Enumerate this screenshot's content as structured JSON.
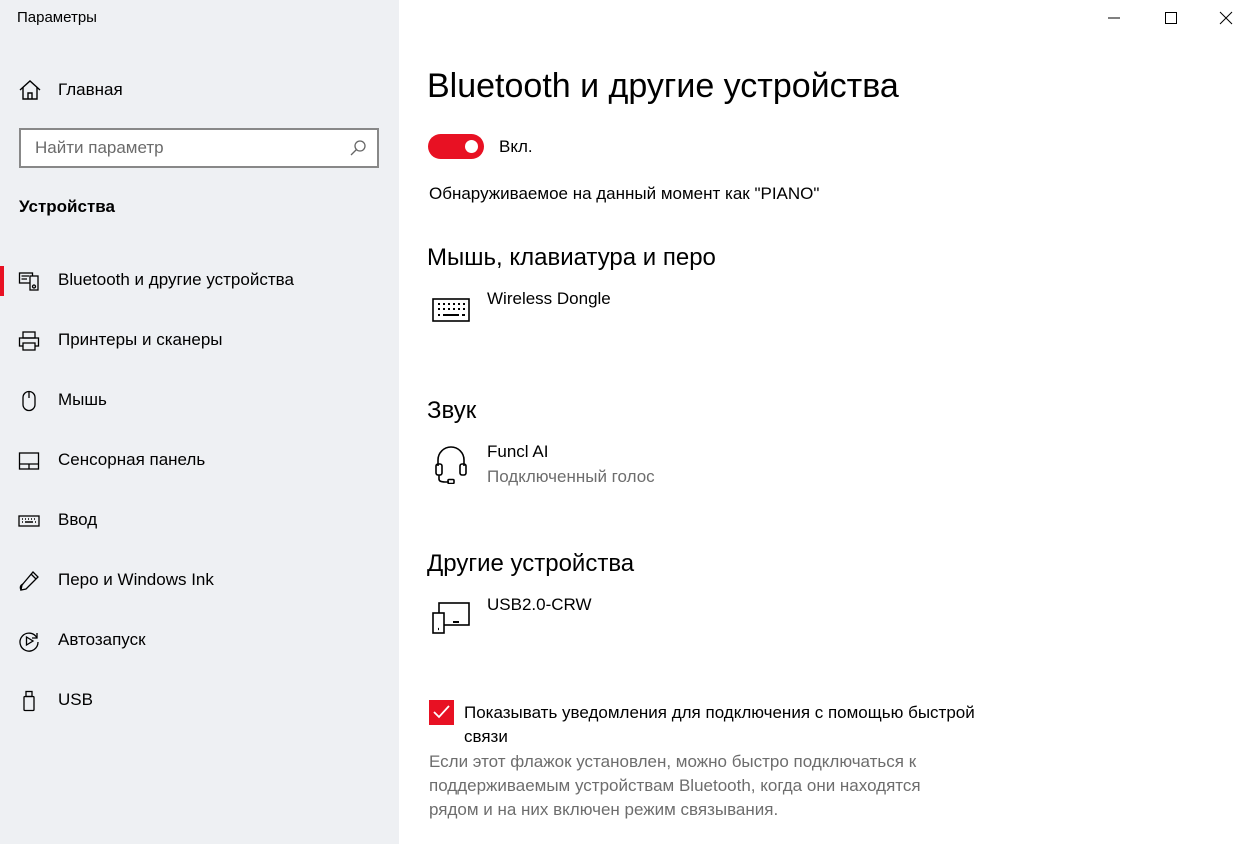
{
  "window": {
    "title": "Параметры",
    "controls": {
      "minimize": "minimize-icon",
      "maximize": "maximize-icon",
      "close": "close-icon"
    }
  },
  "sidebar": {
    "home_label": "Главная",
    "search": {
      "placeholder": "Найти параметр"
    },
    "section": "Устройства",
    "items": [
      {
        "label": "Bluetooth и другие устройства",
        "icon": "bluetooth-devices-icon",
        "active": true
      },
      {
        "label": "Принтеры и сканеры",
        "icon": "printer-icon",
        "active": false
      },
      {
        "label": "Мышь",
        "icon": "mouse-icon",
        "active": false
      },
      {
        "label": "Сенсорная панель",
        "icon": "touchpad-icon",
        "active": false
      },
      {
        "label": "Ввод",
        "icon": "keyboard-icon",
        "active": false
      },
      {
        "label": "Перо и Windows Ink",
        "icon": "pen-icon",
        "active": false
      },
      {
        "label": "Автозапуск",
        "icon": "autoplay-icon",
        "active": false
      },
      {
        "label": "USB",
        "icon": "usb-icon",
        "active": false
      }
    ]
  },
  "main": {
    "title": "Bluetooth и другие устройства",
    "bluetooth_toggle": {
      "label": "Вкл.",
      "on": true
    },
    "discoverable": "Обнаруживаемое на данный момент как \"PIANO\"",
    "groups": [
      {
        "title": "Мышь, клавиатура и перо",
        "devices": [
          {
            "name": "Wireless Dongle",
            "status": "",
            "icon": "keyboard-icon"
          }
        ]
      },
      {
        "title": "Звук",
        "devices": [
          {
            "name": "Funcl AI",
            "status": "Подключенный голос",
            "icon": "headset-icon"
          }
        ]
      },
      {
        "title": "Другие устройства",
        "devices": [
          {
            "name": "USB2.0-CRW",
            "status": "",
            "icon": "generic-device-icon"
          }
        ]
      }
    ],
    "swift_pair": {
      "checked": true,
      "label": "Показывать уведомления для подключения с помощью быстрой связи",
      "description": "Если этот флажок установлен, можно быстро подключаться к поддерживаемым устройствам Bluetooth, когда они находятся рядом и на них включен режим связывания."
    }
  },
  "colors": {
    "accent": "#e81123",
    "sidebar_bg": "#eef0f3",
    "secondary_text": "#6d6d6d"
  }
}
